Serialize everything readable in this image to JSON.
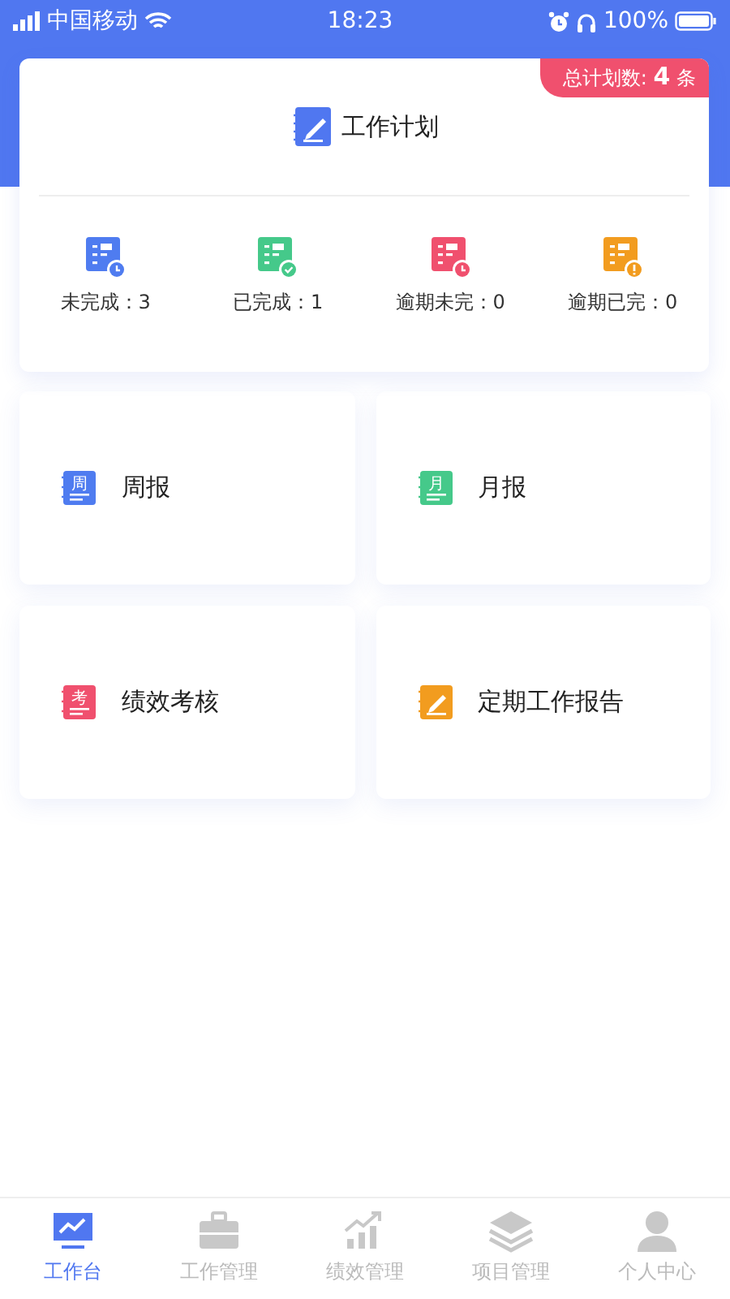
{
  "status_bar": {
    "carrier": "中国移动",
    "time": "18:23",
    "battery": "100%"
  },
  "plan_card": {
    "badge": "总计划数: **4** 条",
    "title": "工作计划",
    "stats": [
      {
        "label": "未完成：3",
        "color": "#4f7cf0",
        "kind": "clock"
      },
      {
        "label": "已完成：1",
        "color": "#45c98a",
        "kind": "check"
      },
      {
        "label": "逾期未完：0",
        "color": "#f0506e",
        "kind": "clock"
      },
      {
        "label": "逾期已完：0",
        "color": "#f29c1f",
        "kind": "alert"
      }
    ]
  },
  "tiles": [
    {
      "label": "周报",
      "color": "#4f7cf0",
      "kind": "char",
      "icon_char": "周"
    },
    {
      "label": "月报",
      "color": "#45c98a",
      "kind": "char",
      "icon_char": "月"
    },
    {
      "label": "绩效考核",
      "color": "#f0506e",
      "kind": "char",
      "icon_char": "考"
    },
    {
      "label": "定期工作报告",
      "color": "#f29c1f",
      "kind": "pencil"
    }
  ],
  "tab_bar": [
    {
      "label": "工作台",
      "kind": "monitor",
      "selected": true
    },
    {
      "label": "工作管理",
      "kind": "briefcase",
      "selected": false
    },
    {
      "label": "绩效管理",
      "kind": "growth",
      "selected": false
    },
    {
      "label": "项目管理",
      "kind": "layers",
      "selected": false
    },
    {
      "label": "个人中心",
      "kind": "person",
      "selected": false
    }
  ]
}
